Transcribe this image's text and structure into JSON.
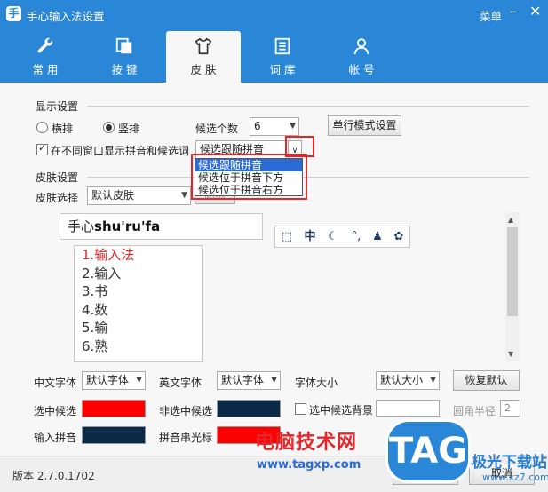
{
  "title": "手心输入法设置",
  "title_menu": "菜单",
  "tabs": [
    {
      "label": "常用",
      "icon": "wrench-icon"
    },
    {
      "label": "按键",
      "icon": "key-icon"
    },
    {
      "label": "皮肤",
      "icon": "shirt-icon"
    },
    {
      "label": "词库",
      "icon": "book-icon"
    },
    {
      "label": "帐号",
      "icon": "user-icon"
    }
  ],
  "display": {
    "section_title": "显示设置",
    "horizontal": "横排",
    "vertical": "竖排",
    "candidate_count_label": "候选个数",
    "candidate_count_value": "6",
    "single_line_btn": "单行模式设置",
    "show_pinyin_label": "在不同窗口显示拼音和候选词",
    "pinyin_position_value": "候选跟随拼音",
    "dropdown_options": [
      "候选跟随拼音",
      "候选位于拼音下方",
      "候选位于拼音右方"
    ]
  },
  "skin": {
    "section_title": "皮肤设置",
    "choose_label": "皮肤选择",
    "choose_value": "默认皮肤",
    "delete_btn": "删除"
  },
  "preview": {
    "prefix": "手心",
    "pinyin": "shu'ru'fa",
    "candidates": [
      "1.输入法",
      "2.输入",
      "3.书",
      "4.数",
      "5.输",
      "6.熟"
    ]
  },
  "fonts": {
    "cn_font_label": "中文字体",
    "cn_font_value": "默认字体",
    "en_font_label": "英文字体",
    "en_font_value": "默认字体",
    "size_label": "字体大小",
    "size_value": "默认大小",
    "restore_btn": "恢复默认"
  },
  "colors": {
    "selected_label": "选中候选",
    "unselected_label": "非选中候选",
    "selected_bg_label": "选中候选背景",
    "radius_label": "圆角半径",
    "radius_value": "2",
    "input_pinyin_label": "输入拼音",
    "cursor_label": "拼音串光标",
    "selected_color": "#ff0000",
    "unselected_color": "#0b2a48",
    "input_pinyin_color": "#0b2a48",
    "cursor_color": "#ff0000"
  },
  "footer": {
    "version": "版本 2.7.0.1702",
    "ok_btn": "确定",
    "cancel_btn": "取消"
  },
  "watermark": {
    "site_name": "电脑技术网",
    "site_url": "www.tagxp.com",
    "logo": "TAG",
    "download": "极光下载站",
    "download_url": "www.xz7.com"
  }
}
